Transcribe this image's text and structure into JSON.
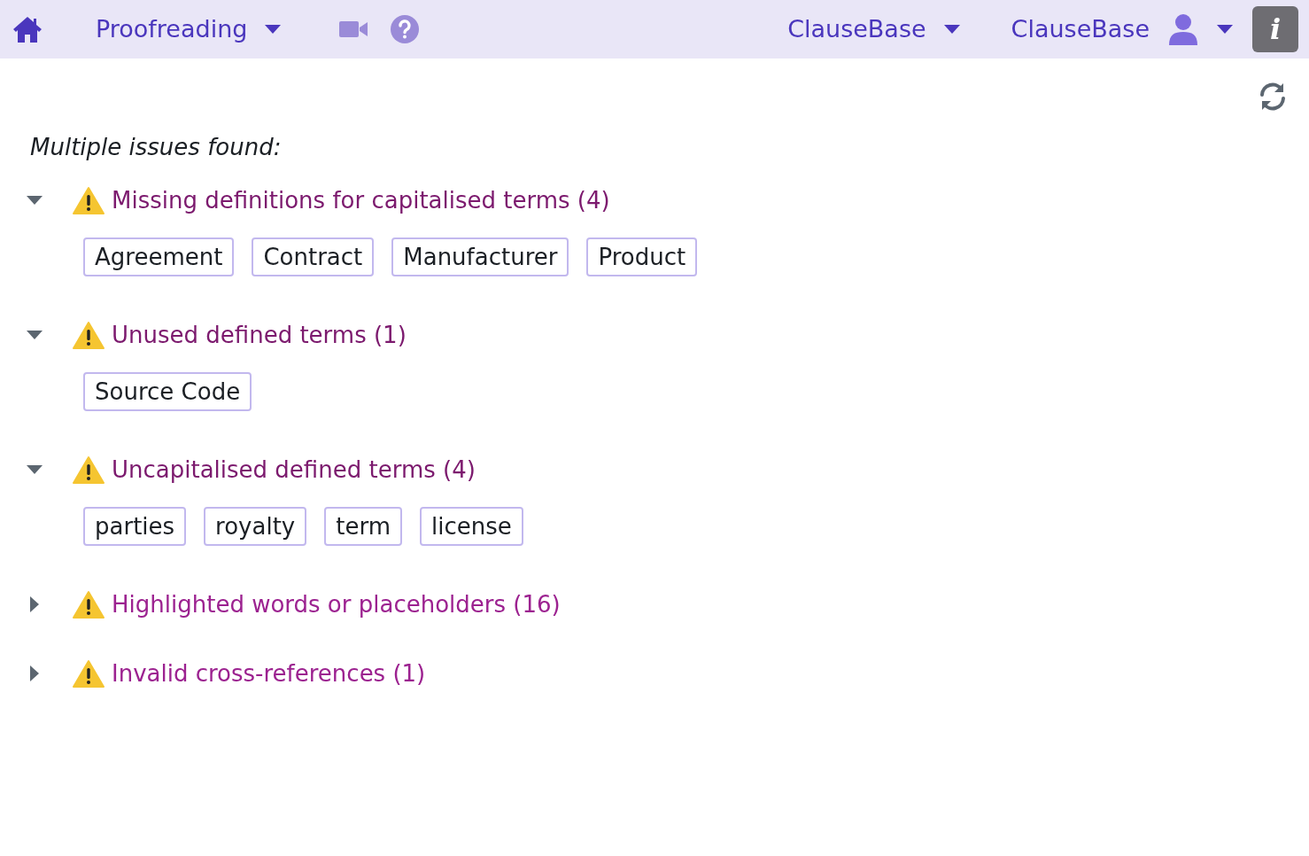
{
  "navbar": {
    "module": "Proofreading",
    "workspace": "ClauseBase",
    "user": "ClauseBase",
    "info_button": "i"
  },
  "summary": "Multiple issues found:",
  "issues": [
    {
      "title": "Missing definitions for capitalised terms (4)",
      "expanded": true,
      "terms": [
        "Agreement",
        "Contract",
        "Manufacturer",
        "Product"
      ]
    },
    {
      "title": "Unused defined terms (1)",
      "expanded": true,
      "terms": [
        "Source Code"
      ]
    },
    {
      "title": "Uncapitalised defined terms (4)",
      "expanded": true,
      "terms": [
        "parties",
        "royalty",
        "term",
        "license"
      ]
    },
    {
      "title": "Highlighted words or placeholders (16)",
      "expanded": false
    },
    {
      "title": "Invalid cross-references (1)",
      "expanded": false
    }
  ]
}
